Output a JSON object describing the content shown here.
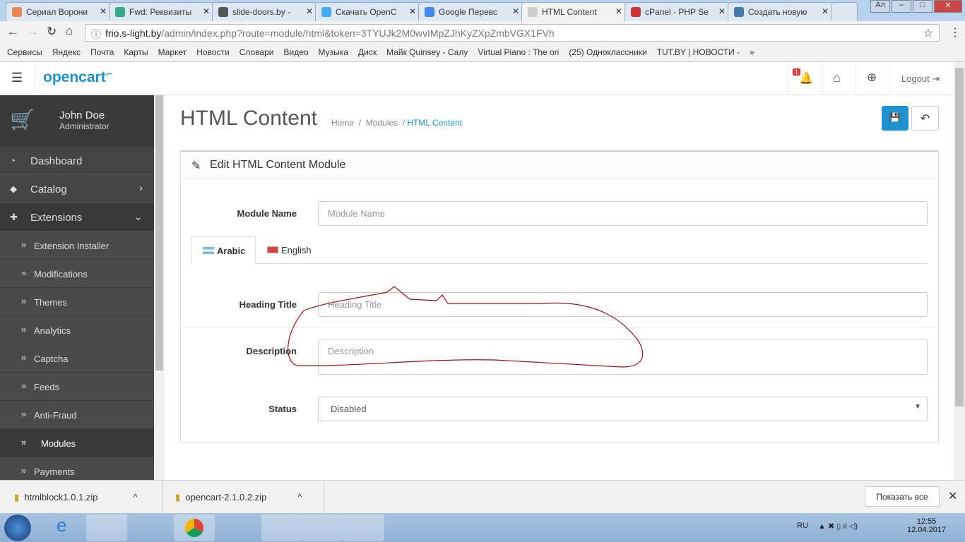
{
  "browser": {
    "tabs": [
      {
        "title": "Сериал Ворони",
        "color": "#e85"
      },
      {
        "title": "Fwd: Реквизиты",
        "color": "#3a8"
      },
      {
        "title": "slide-doors.by -",
        "color": "#555"
      },
      {
        "title": "Скачать OpenC",
        "color": "#4af"
      },
      {
        "title": "Google Перевс",
        "color": "#48e"
      },
      {
        "title": "HTML Content",
        "color": "#ccc",
        "active": true
      },
      {
        "title": "cPanel - PHP Se",
        "color": "#c33"
      },
      {
        "title": "Создать новую",
        "color": "#47a"
      }
    ],
    "url_host": "frio.s-light.by",
    "url_path": "/admin/index.php?route=module/html&token=3TYUJk2M0wvIMpZJhKyZXpZmbVGX1FVh",
    "window_user": "Ал",
    "bookmarks": [
      "Сервисы",
      "Яндекс",
      "Почта",
      "Карты",
      "Маркет",
      "Новости",
      "Словари",
      "Видео",
      "Музыка",
      "Диск",
      "Майк Quinsey - Салу",
      "Virtual Piano : The ori",
      "(25) Одноклассники",
      "TUT.BY | НОВОСТИ -"
    ]
  },
  "header": {
    "logo": "opencart",
    "notif_count": "1",
    "logout": "Logout"
  },
  "sidebar": {
    "user_name": "John Doe",
    "user_role": "Administrator",
    "items": [
      {
        "label": "Dashboard",
        "icon": "dashboard-icon"
      },
      {
        "label": "Catalog",
        "icon": "tags-icon",
        "arrow": "›"
      },
      {
        "label": "Extensions",
        "icon": "puzzle-icon",
        "arrow": "⌄"
      }
    ],
    "sub": [
      "Extension Installer",
      "Modifications",
      "Themes",
      "Analytics",
      "Captcha",
      "Feeds",
      "Anti-Fraud",
      "Modules",
      "Payments"
    ],
    "active_sub": "Modules"
  },
  "page": {
    "title": "HTML Content",
    "breadcrumb": [
      "Home",
      "Modules",
      "HTML Content"
    ],
    "panel_title": "Edit HTML Content Module",
    "module_name_label": "Module Name",
    "module_name_placeholder": "Module Name",
    "lang_tabs": [
      "Arabic",
      "English"
    ],
    "heading_label": "Heading Title",
    "heading_placeholder": "Heading Title",
    "desc_label": "Description",
    "desc_placeholder": "Description",
    "status_label": "Status",
    "status_value": "Disabled",
    "accent": "#1e91cf",
    "annotation_color": "#a01010"
  },
  "downloads": {
    "files": [
      "htmlblock1.0.1.zip",
      "opencart-2.1.0.2.zip"
    ],
    "show_all": "Показать все"
  },
  "taskbar": {
    "lang": "RU",
    "time": "12:55",
    "date": "12.04.2017"
  }
}
